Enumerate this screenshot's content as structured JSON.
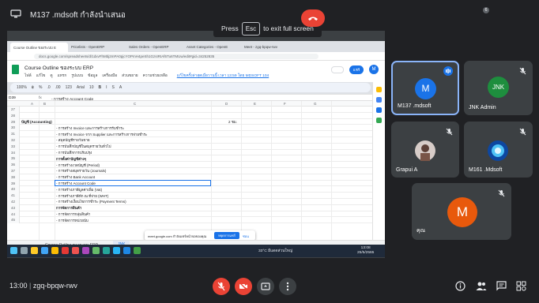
{
  "presenter": {
    "text": "M137 .mdsoft กำลังนำเสนอ"
  },
  "fullscreen_hint": {
    "pre": "Press",
    "key": "Esc",
    "post": "to exit full screen"
  },
  "browser": {
    "tabs": [
      "Course Outline ของระบบ E",
      "Pricelists - OpenERP",
      "Sales Orders - OpenERP",
      "Asset Categories - OpenE",
      "Meet - zgq-bpqw-rwv"
    ],
    "url": "docs.google.com/spreadsheets/d/1dxvFhMbj2mPA0pjcYOPmH4peSh1GzsIRIAf6Tu6TMUw/edit#gid=34252835"
  },
  "sheet": {
    "title": "Course Outline ของระบบ ERP",
    "menus": [
      "ไฟล์",
      "แก้ไข",
      "ดู",
      "แทรก",
      "รูปแบบ",
      "ข้อมูล",
      "เครื่องมือ",
      "ส่วนขยาย",
      "ความช่วยเหลือ"
    ],
    "last_edit": "แก้ไขครั้งล่าสุดเมื่อวานนี้ เวลา 13:59 โดย MDSOFT 104",
    "share_label": "แชร์",
    "account_initial": "M",
    "toolbar": [
      "100%",
      "฿",
      "%",
      ".0",
      ".00",
      "123",
      "Arial",
      "10",
      "B",
      "I",
      "S",
      "A"
    ],
    "cell_ref": "D39",
    "formula": "- การสร้าง Account Code",
    "columns": [
      "A",
      "B",
      "C",
      "D",
      "E",
      "F",
      "G"
    ],
    "rows": [
      {
        "n": "27",
        "b": "",
        "c": "",
        "bold": false
      },
      {
        "n": "28",
        "b": "",
        "c": "",
        "bold": false
      },
      {
        "n": "29",
        "b": "บัญชี (Accounting)",
        "c": "2 ชม.",
        "bold": true
      },
      {
        "n": "30",
        "b": "- การสร้าง Invoice และการสร้างการรับชำระ",
        "c": "",
        "bold": false
      },
      {
        "n": "31",
        "b": "- การสร้าง Invoice จาก Supplier และการสร้างการจ่ายชำระ",
        "c": "",
        "bold": false
      },
      {
        "n": "32",
        "b": "- สมุดบัญชีรายวันขาย",
        "c": "",
        "bold": false
      },
      {
        "n": "33",
        "b": "- การบันทึกบัญชีในสมุดรายวันทั่วไป",
        "c": "",
        "bold": false
      },
      {
        "n": "34",
        "b": "- การบันทึกการปรับปรุง",
        "c": "",
        "bold": false
      },
      {
        "n": "35",
        "b": "การตั้งค่าบัญชีต่างๆ",
        "c": "",
        "bold": true
      },
      {
        "n": "36",
        "b": "- การสร้างงวดบัญชี (Period)",
        "c": "",
        "bold": false
      },
      {
        "n": "37",
        "b": "- การสร้างสมุดรายวัน (Journals)",
        "c": "",
        "bold": false
      },
      {
        "n": "38",
        "b": "- การสร้าง Bank Account",
        "c": "",
        "bold": false
      },
      {
        "n": "39",
        "b": "- การสร้าง Account Code",
        "c": "",
        "bold": false
      },
      {
        "n": "40",
        "b": "- การสร้างภาษีมูลค่าเพิ่ม (Vat)",
        "c": "",
        "bold": false
      },
      {
        "n": "41",
        "b": "- การสร้างภาษีหัก ณ ที่จ่าย (WHT)",
        "c": "",
        "bold": false
      },
      {
        "n": "42",
        "b": "- การสร้างเงื่อนไขการชำระ (Payment Terms)",
        "c": "",
        "bold": false
      },
      {
        "n": "43",
        "b": "การจัดการสินค้า",
        "c": "",
        "bold": true
      },
      {
        "n": "44",
        "b": "- การจัดการกลุ่มสินค้า",
        "c": "",
        "bold": false
      },
      {
        "n": "45",
        "b": "- การจัดการหน่วยนับ",
        "c": "",
        "bold": false
      }
    ],
    "sheet_tabs": [
      "Course Outline ของระบบ ERP",
      "JNK"
    ],
    "share_notification": {
      "message": "meet.google.com กำลังแชร์หน้าจอของคุณ",
      "stop": "หยุดการแชร์",
      "hide": "ซ่อน"
    }
  },
  "taskbar": {
    "weather": "33°C มีแดดส่วนใหญ่",
    "time": "13:08",
    "date": "25/5/2565"
  },
  "participants": [
    {
      "name": "M137 .mdsoft",
      "initial": "M",
      "color": "#1a73e8"
    },
    {
      "name": "JNK Admin",
      "initial": "JNK",
      "color": "#1e8e3e"
    },
    {
      "name": "Grapui A",
      "initial": "",
      "color": "#8d6e63"
    },
    {
      "name": "M161 .Mdsoft",
      "initial": "",
      "color": "#1565c0"
    },
    {
      "name": "คุณ",
      "initial": "M",
      "color": "#e8590c"
    }
  ],
  "bottom_bar": {
    "time": "13:00",
    "meeting_code": "zgq-bpqw-rwv",
    "people_count": "6"
  },
  "icons": [
    "monitor-icon",
    "mic-off-icon",
    "camera-off-icon",
    "present-icon",
    "more-icon",
    "end-call-icon",
    "info-icon",
    "people-icon",
    "chat-icon",
    "activities-icon"
  ]
}
